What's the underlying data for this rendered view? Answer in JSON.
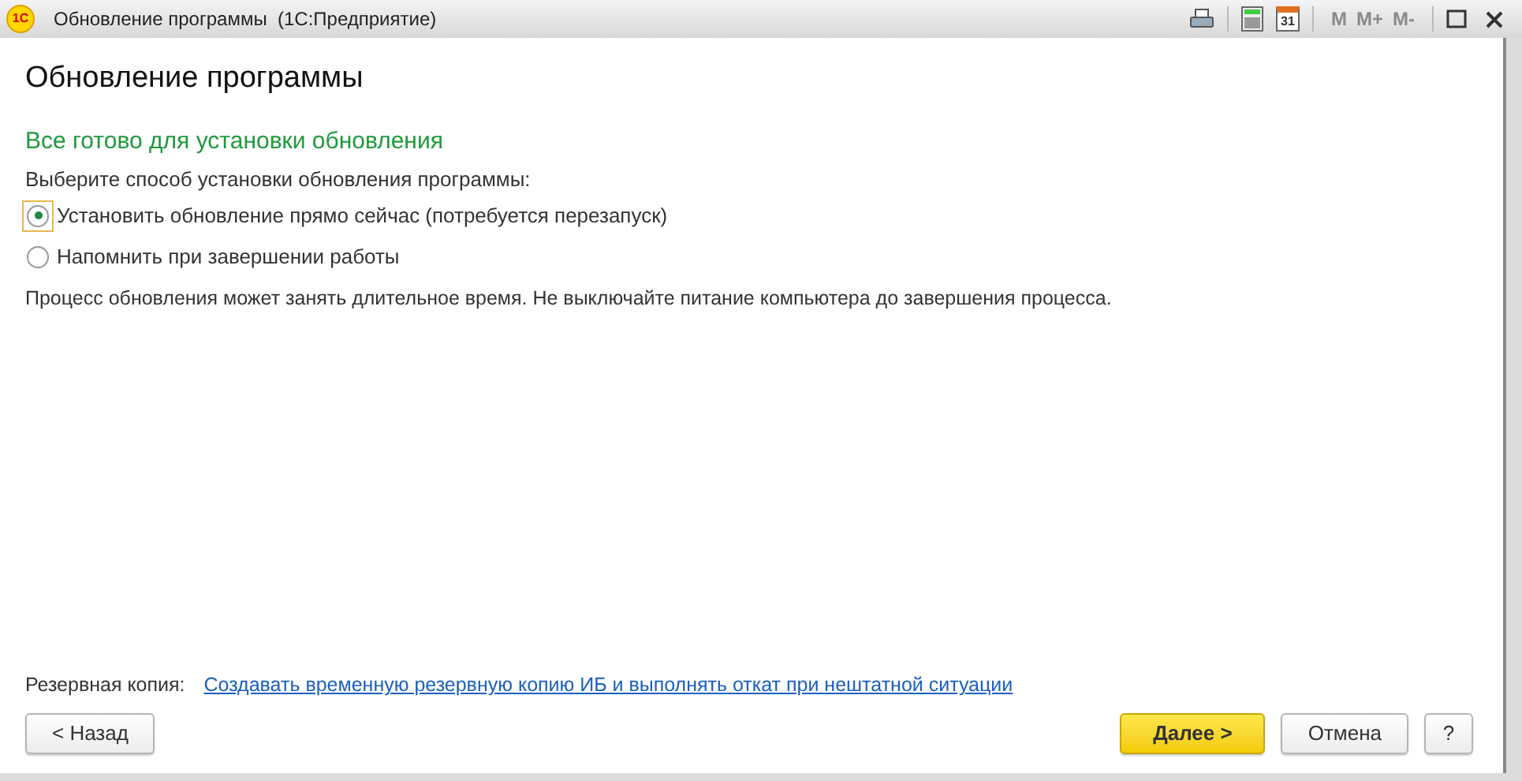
{
  "window": {
    "logo": "1С",
    "title": "Обновление программы  (1С:Предприятие)"
  },
  "toolbar": {
    "calendar_day": "31",
    "memory_buttons": [
      {
        "label": "M",
        "disabled": true
      },
      {
        "label": "M+",
        "disabled": true
      },
      {
        "label": "M-",
        "disabled": true
      }
    ]
  },
  "heading": "Обновление программы",
  "subtitle": "Все готово для установки обновления",
  "prompt": "Выберите способ установки обновления программы:",
  "options": [
    {
      "label": "Установить обновление прямо сейчас (потребуется перезапуск)",
      "selected": true
    },
    {
      "label": "Напомнить при завершении работы",
      "selected": false
    }
  ],
  "note": "Процесс обновления может занять длительное время. Не выключайте питание компьютера до завершения процесса.",
  "backup": {
    "label": "Резервная копия:",
    "link": "Создавать временную резервную копию ИБ и выполнять откат при нештатной ситуации"
  },
  "buttons": [
    {
      "label": "< Назад",
      "kind": "normal"
    },
    {
      "label": "Далее >",
      "kind": "default"
    },
    {
      "label": "Отмена",
      "kind": "normal"
    },
    {
      "label": "?",
      "kind": "help"
    }
  ]
}
